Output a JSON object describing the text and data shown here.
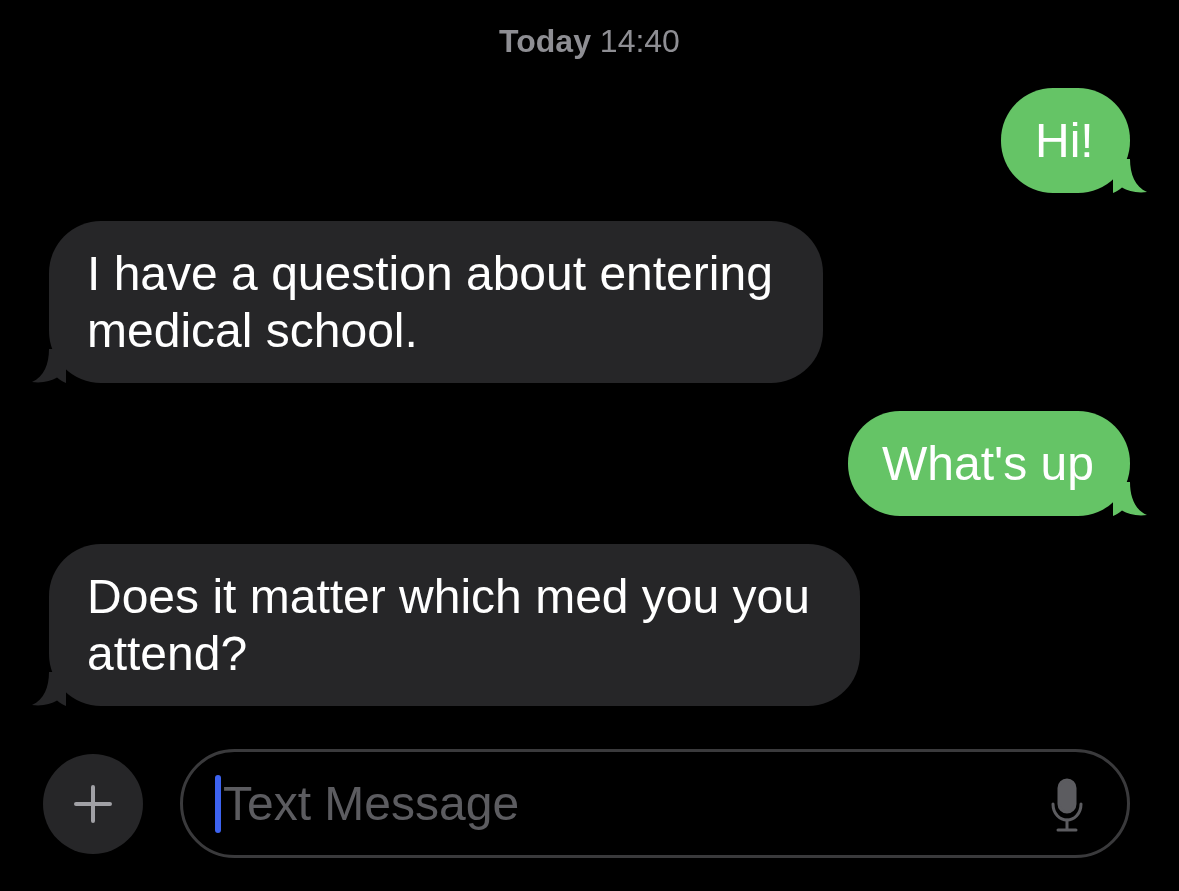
{
  "timestamp": "**Today** 14:40",
  "messages": [
    {
      "kind": "sent",
      "text": "Hi!"
    },
    {
      "kind": "received",
      "text": "I have a question about entering medical school."
    },
    {
      "kind": "sent",
      "text": "What's up"
    },
    {
      "kind": "received",
      "text": "Does it matter which med you you attend?"
    }
  ],
  "composer": {
    "placeholder": "Text Message"
  }
}
